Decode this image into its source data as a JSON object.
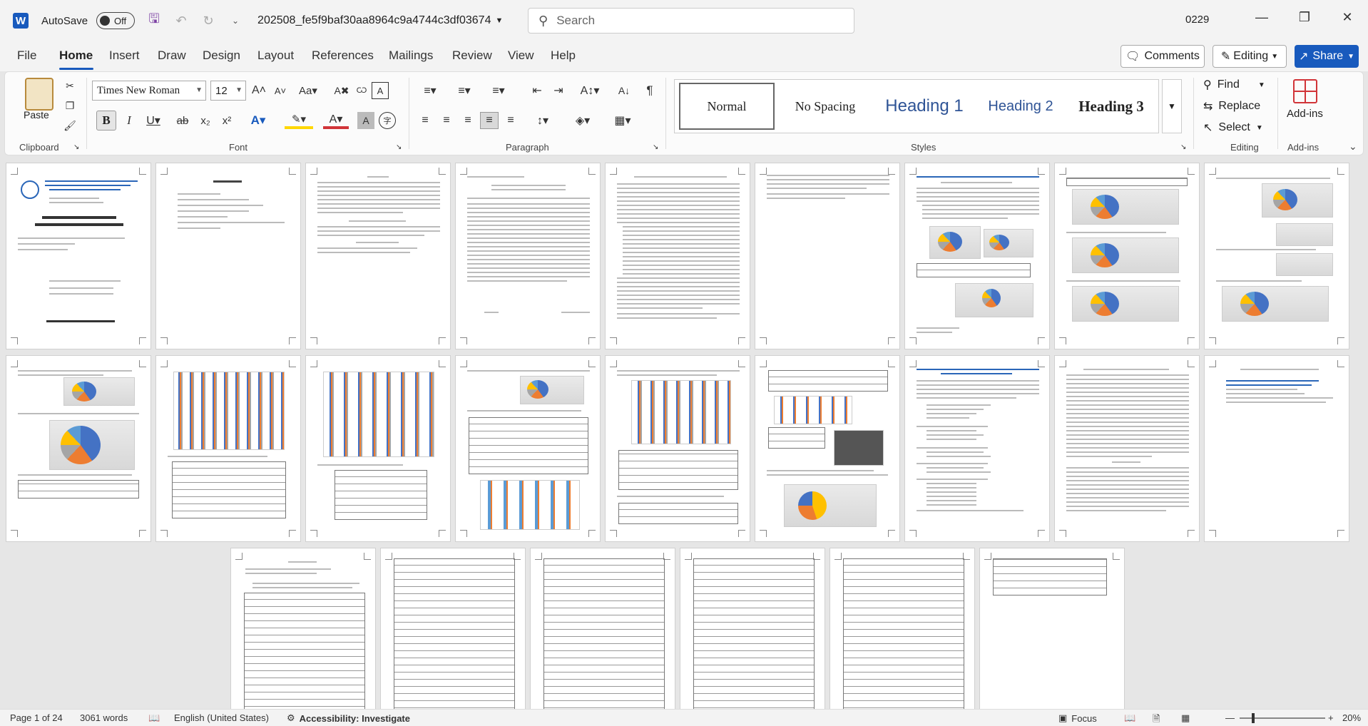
{
  "titlebar": {
    "autosave_label": "AutoSave",
    "autosave_state": "Off",
    "doc_title": "202508_fe5f9baf30aa8964c9a4744c3df03674",
    "search_placeholder": "Search",
    "user_id": "0229"
  },
  "menu": {
    "tabs": [
      "File",
      "Home",
      "Insert",
      "Draw",
      "Design",
      "Layout",
      "References",
      "Mailings",
      "Review",
      "View",
      "Help"
    ],
    "active": "Home",
    "comments_label": "Comments",
    "editing_label": "Editing",
    "share_label": "Share"
  },
  "ribbon": {
    "groups": [
      "Clipboard",
      "Font",
      "Paragraph",
      "Styles",
      "Editing",
      "Add-ins"
    ],
    "paste_label": "Paste",
    "font_name": "Times New Roman",
    "font_size": "12",
    "styles": [
      "Normal",
      "No Spacing",
      "Heading 1",
      "Heading 2",
      "Heading 3"
    ],
    "find_label": "Find",
    "replace_label": "Replace",
    "select_label": "Select",
    "addins_label": "Add-ins"
  },
  "colors": {
    "accent": "#185abd",
    "heading": "#2f5496",
    "highlight": "#ffd700",
    "font_color": "#d13438"
  },
  "status": {
    "page": "Page 1 of 24",
    "words": "3061 words",
    "language": "English (United States)",
    "accessibility": "Accessibility: Investigate",
    "focus": "Focus",
    "zoom": "20%"
  }
}
